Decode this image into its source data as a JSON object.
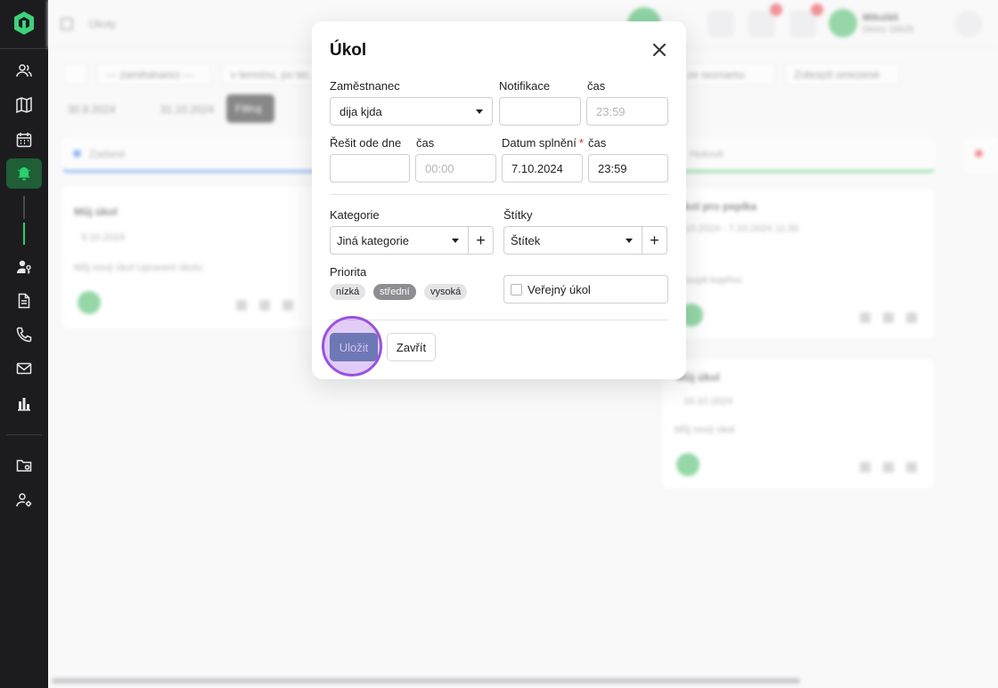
{
  "app": {
    "breadcrumb": "Úkoly",
    "user_name": "Mikuláš",
    "user_sub": "Demo 16625"
  },
  "filters": {
    "employees": "--- zaměstnanci ---",
    "term": "v termínu, po ter...",
    "list": "ze seznamu",
    "show_limit": "Zobrazit omezené",
    "date_from": "30.9.2024",
    "date_to": "31.10.2024",
    "filter_btn": "Filtruj"
  },
  "board": {
    "col1_title": "Zadané",
    "col2_title": "Hotové",
    "card1_title": "Můj úkol",
    "card1_date": "9.10.2024",
    "card1_text": "Můj nový úkol Upravení úkolu",
    "card2_title": "Úkol pro pepíka",
    "card2_date": "6.10.2024 - 7.10.2024 11:30",
    "card2_text": "Koupit kopřivu",
    "card3_title": "Můj úkol",
    "card3_date": "16.10.2024",
    "card3_text": "Můj nový úkol"
  },
  "modal": {
    "title": "Úkol",
    "employee_label": "Zaměstnanec",
    "employee_value": "dija kjda",
    "notification_label": "Notifikace",
    "notification_time_label": "čas",
    "notification_time_placeholder": "23:59",
    "solve_from_label": "Řešit ode dne",
    "solve_from_time_label": "čas",
    "solve_from_time_placeholder": "00:00",
    "due_label": "Datum splnění",
    "due_required": "*",
    "due_value": "7.10.2024",
    "due_time_label": "čas",
    "due_time_value": "23:59",
    "category_label": "Kategorie",
    "category_value": "Jiná kategorie",
    "tags_label": "Štítky",
    "tags_value": "Štítek",
    "plus": "+",
    "priority_label": "Priorita",
    "priority_options": [
      "nízká",
      "střední",
      "vysoká"
    ],
    "priority_selected": "střední",
    "public_label": "Veřejný úkol",
    "save": "Uložit",
    "close": "Zavřít"
  },
  "colors": {
    "sidebar_bg": "#1c1c1e",
    "active_green": "#29d16d",
    "save_button": "#4f7f9b",
    "highlight": "#9a52e0"
  },
  "icons": [
    "logo-icon",
    "users-icon",
    "map-icon",
    "calendar-icon",
    "bell-icon",
    "user-key-icon",
    "document-icon",
    "phone-icon",
    "mail-icon",
    "chart-icon",
    "folder-settings-icon",
    "user-settings-icon",
    "close-icon",
    "chevron-down-icon"
  ]
}
